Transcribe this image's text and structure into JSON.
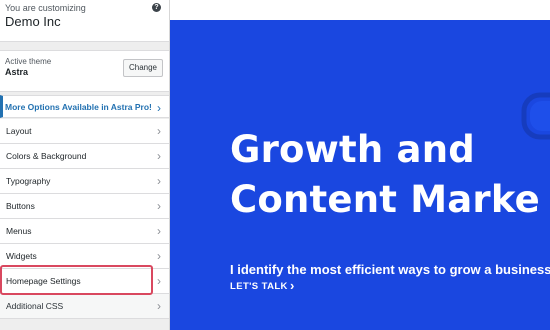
{
  "customizer": {
    "subtitle": "You are customizing",
    "site_title": "Demo Inc",
    "help_glyph": "?"
  },
  "theme": {
    "label": "Active theme",
    "name": "Astra",
    "change_button": "Change"
  },
  "promo": {
    "label": "More Options Available in Astra Pro!"
  },
  "menu": {
    "items": [
      {
        "label": "Layout"
      },
      {
        "label": "Colors & Background"
      },
      {
        "label": "Typography"
      },
      {
        "label": "Buttons"
      },
      {
        "label": "Menus"
      },
      {
        "label": "Widgets"
      },
      {
        "label": "Homepage Settings"
      },
      {
        "label": "Additional CSS"
      }
    ],
    "highlighted": "Additional CSS"
  },
  "preview": {
    "headline_line1": "Growth and",
    "headline_line2": "Content Marke",
    "tagline": "I identify the most efficient ways to grow a business.",
    "cta_label": "LET'S TALK"
  },
  "icons": {
    "chevron": "chevron-right-icon",
    "help": "help-icon",
    "glasses": "glasses-icon"
  },
  "colors": {
    "hero_bg": "#1a47e0",
    "promo_accent": "#2271b1",
    "highlight_border": "#d9485f"
  }
}
